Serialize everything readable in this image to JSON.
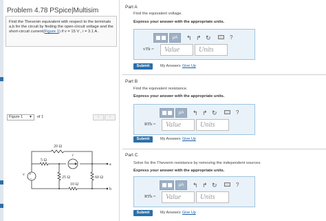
{
  "problem": {
    "title": "Problem 4.78 PSpice|Multisim",
    "text_before_link": "Find the Thevenin equivalent with respect to the terminals a,b for the circuit by finding the open-circuit voltage and the short-circuit current(",
    "link_text": "Figure 1",
    "text_after_link": ") if v = 15 V , i = 3.1 A ."
  },
  "figure_nav": {
    "selected": "Figure 1",
    "of_text": "of 1",
    "prev": "‹",
    "next": "›"
  },
  "circuit": {
    "labels": {
      "r_top": "20 Ω",
      "r_left": "5 Ω",
      "r_mid": "25 Ω",
      "r_right": "60 Ω",
      "r_bottom": "10 Ω",
      "current_source": "i",
      "voltage_source": "v",
      "node_a": "a",
      "node_b": "b"
    }
  },
  "toolbar": {
    "mu_label": "μA",
    "undo_icon": "undo-icon",
    "redo_icon": "redo-icon",
    "reset_icon": "reset-icon",
    "keyboard_icon": "keyboard-icon",
    "help_label": "?"
  },
  "common": {
    "submit": "Submit",
    "my_answers": "My Answers",
    "give_up": "Give Up",
    "value_placeholder": "Value",
    "units_placeholder": "Units",
    "express": "Express your answer with the appropriate units."
  },
  "parts": [
    {
      "title": "Part A",
      "prompt": "Find the equivalent voltage.",
      "var": "vTh ="
    },
    {
      "title": "Part B",
      "prompt": "Find the equivalent resistance.",
      "var": "RTh ="
    },
    {
      "title": "Part C",
      "prompt": "Solve for the Thevenin resistance by removing the independent sources.",
      "var": "RTh ="
    }
  ],
  "colors": {
    "accent": "#2d6fa8",
    "answer_bg": "#eaf2f9",
    "toolbar_btn": "#9eb0c4"
  }
}
